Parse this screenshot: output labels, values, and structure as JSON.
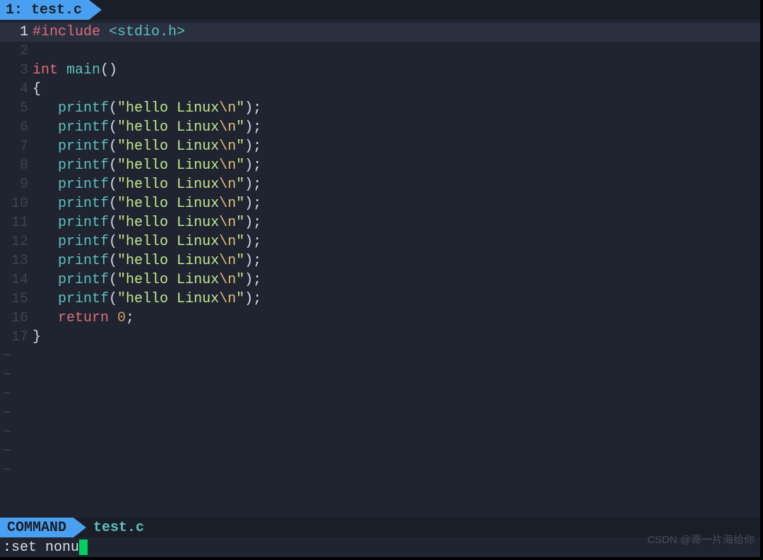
{
  "tab": {
    "label": "1: test.c"
  },
  "lines": [
    {
      "n": 1,
      "current": true,
      "tokens": [
        {
          "t": "#include ",
          "c": "preproc"
        },
        {
          "t": "<stdio.h>",
          "c": "angle"
        }
      ]
    },
    {
      "n": 2,
      "tokens": []
    },
    {
      "n": 3,
      "tokens": [
        {
          "t": "int ",
          "c": "type"
        },
        {
          "t": "main",
          "c": "func"
        },
        {
          "t": "()",
          "c": "punct"
        }
      ]
    },
    {
      "n": 4,
      "tokens": [
        {
          "t": "{",
          "c": "punct"
        }
      ]
    },
    {
      "n": 5,
      "tokens": [
        {
          "t": "   ",
          "c": "code"
        },
        {
          "t": "printf",
          "c": "funcall"
        },
        {
          "t": "(",
          "c": "punct"
        },
        {
          "t": "\"hello Linux",
          "c": "string"
        },
        {
          "t": "\\n",
          "c": "escape"
        },
        {
          "t": "\"",
          "c": "string"
        },
        {
          "t": ");",
          "c": "punct"
        }
      ]
    },
    {
      "n": 6,
      "tokens": [
        {
          "t": "   ",
          "c": "code"
        },
        {
          "t": "printf",
          "c": "funcall"
        },
        {
          "t": "(",
          "c": "punct"
        },
        {
          "t": "\"hello Linux",
          "c": "string"
        },
        {
          "t": "\\n",
          "c": "escape"
        },
        {
          "t": "\"",
          "c": "string"
        },
        {
          "t": ");",
          "c": "punct"
        }
      ]
    },
    {
      "n": 7,
      "tokens": [
        {
          "t": "   ",
          "c": "code"
        },
        {
          "t": "printf",
          "c": "funcall"
        },
        {
          "t": "(",
          "c": "punct"
        },
        {
          "t": "\"hello Linux",
          "c": "string"
        },
        {
          "t": "\\n",
          "c": "escape"
        },
        {
          "t": "\"",
          "c": "string"
        },
        {
          "t": ");",
          "c": "punct"
        }
      ]
    },
    {
      "n": 8,
      "tokens": [
        {
          "t": "   ",
          "c": "code"
        },
        {
          "t": "printf",
          "c": "funcall"
        },
        {
          "t": "(",
          "c": "punct"
        },
        {
          "t": "\"hello Linux",
          "c": "string"
        },
        {
          "t": "\\n",
          "c": "escape"
        },
        {
          "t": "\"",
          "c": "string"
        },
        {
          "t": ");",
          "c": "punct"
        }
      ]
    },
    {
      "n": 9,
      "tokens": [
        {
          "t": "   ",
          "c": "code"
        },
        {
          "t": "printf",
          "c": "funcall"
        },
        {
          "t": "(",
          "c": "punct"
        },
        {
          "t": "\"hello Linux",
          "c": "string"
        },
        {
          "t": "\\n",
          "c": "escape"
        },
        {
          "t": "\"",
          "c": "string"
        },
        {
          "t": ");",
          "c": "punct"
        }
      ]
    },
    {
      "n": 10,
      "tokens": [
        {
          "t": "   ",
          "c": "code"
        },
        {
          "t": "printf",
          "c": "funcall"
        },
        {
          "t": "(",
          "c": "punct"
        },
        {
          "t": "\"hello Linux",
          "c": "string"
        },
        {
          "t": "\\n",
          "c": "escape"
        },
        {
          "t": "\"",
          "c": "string"
        },
        {
          "t": ");",
          "c": "punct"
        }
      ]
    },
    {
      "n": 11,
      "tokens": [
        {
          "t": "   ",
          "c": "code"
        },
        {
          "t": "printf",
          "c": "funcall"
        },
        {
          "t": "(",
          "c": "punct"
        },
        {
          "t": "\"hello Linux",
          "c": "string"
        },
        {
          "t": "\\n",
          "c": "escape"
        },
        {
          "t": "\"",
          "c": "string"
        },
        {
          "t": ");",
          "c": "punct"
        }
      ]
    },
    {
      "n": 12,
      "tokens": [
        {
          "t": "   ",
          "c": "code"
        },
        {
          "t": "printf",
          "c": "funcall"
        },
        {
          "t": "(",
          "c": "punct"
        },
        {
          "t": "\"hello Linux",
          "c": "string"
        },
        {
          "t": "\\n",
          "c": "escape"
        },
        {
          "t": "\"",
          "c": "string"
        },
        {
          "t": ");",
          "c": "punct"
        }
      ]
    },
    {
      "n": 13,
      "tokens": [
        {
          "t": "   ",
          "c": "code"
        },
        {
          "t": "printf",
          "c": "funcall"
        },
        {
          "t": "(",
          "c": "punct"
        },
        {
          "t": "\"hello Linux",
          "c": "string"
        },
        {
          "t": "\\n",
          "c": "escape"
        },
        {
          "t": "\"",
          "c": "string"
        },
        {
          "t": ");",
          "c": "punct"
        }
      ]
    },
    {
      "n": 14,
      "tokens": [
        {
          "t": "   ",
          "c": "code"
        },
        {
          "t": "printf",
          "c": "funcall"
        },
        {
          "t": "(",
          "c": "punct"
        },
        {
          "t": "\"hello Linux",
          "c": "string"
        },
        {
          "t": "\\n",
          "c": "escape"
        },
        {
          "t": "\"",
          "c": "string"
        },
        {
          "t": ");",
          "c": "punct"
        }
      ]
    },
    {
      "n": 15,
      "tokens": [
        {
          "t": "   ",
          "c": "code"
        },
        {
          "t": "printf",
          "c": "funcall"
        },
        {
          "t": "(",
          "c": "punct"
        },
        {
          "t": "\"hello Linux",
          "c": "string"
        },
        {
          "t": "\\n",
          "c": "escape"
        },
        {
          "t": "\"",
          "c": "string"
        },
        {
          "t": ");",
          "c": "punct"
        }
      ]
    },
    {
      "n": 16,
      "tokens": [
        {
          "t": "   ",
          "c": "code"
        },
        {
          "t": "return ",
          "c": "keyword"
        },
        {
          "t": "0",
          "c": "num"
        },
        {
          "t": ";",
          "c": "punct"
        }
      ]
    },
    {
      "n": 17,
      "tokens": [
        {
          "t": "}",
          "c": "punct"
        }
      ]
    }
  ],
  "tilde_count": 7,
  "status": {
    "mode": "COMMAND",
    "filename": "test.c"
  },
  "command": {
    "text": ":set nonu"
  },
  "watermark": "CSDN @寄一片海给你"
}
